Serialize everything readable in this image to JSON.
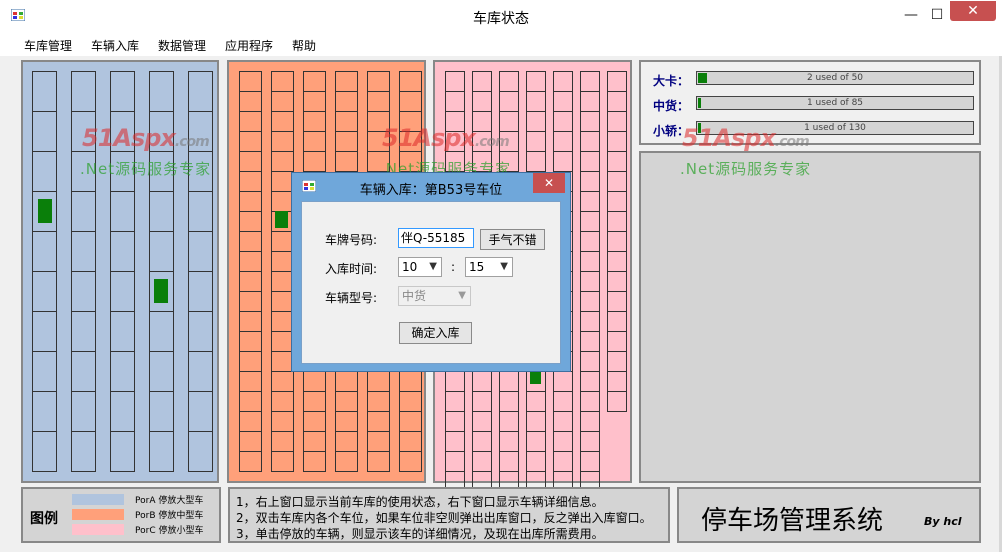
{
  "window": {
    "title": "车库状态"
  },
  "menu": [
    "车库管理",
    "车辆入库",
    "数据管理",
    "应用程序",
    "帮助"
  ],
  "colors": {
    "zoneA": "#b0c4de",
    "zoneB": "#ffa07a",
    "zoneC": "#ffc0cb",
    "occupied": "#0a7f0a"
  },
  "capacity": [
    {
      "label": "大卡：",
      "text": "2 used of 50",
      "fraction": 0.04
    },
    {
      "label": "中货：",
      "text": "1 used of 85",
      "fraction": 0.012
    },
    {
      "label": "小轿：",
      "text": "1 used of 130",
      "fraction": 0.008
    }
  ],
  "watermark": {
    "logo": "51Aspx",
    "logo_suffix": ".com",
    "subtitle": ".Net源码服务专家"
  },
  "legend": {
    "title": "图例",
    "items": [
      "PorA 停放大型车",
      "PorB 停放中型车",
      "PorC 停放小型车"
    ]
  },
  "info_lines": [
    "1，右上窗口显示当前车库的使用状态，右下窗口显示车辆详细信息。",
    "2，双击车库内各个车位，如果车位非空则弹出出库窗口，反之弹出入库窗口。",
    "3，单击停放的车辆，则显示该车的详细情况，及现在出库所需费用。"
  ],
  "brand": {
    "title": "停车场管理系统",
    "by": "By hcl"
  },
  "dialog": {
    "title": "车辆入库：第B53号车位",
    "plate_label": "车牌号码:",
    "plate_value": "伴Q-55185",
    "luck_button": "手气不错",
    "time_label": "入库时间:",
    "hour": "10",
    "colon": ":",
    "minute": "15",
    "type_label": "车辆型号:",
    "type_value": "中货",
    "confirm_button": "确定入库"
  }
}
